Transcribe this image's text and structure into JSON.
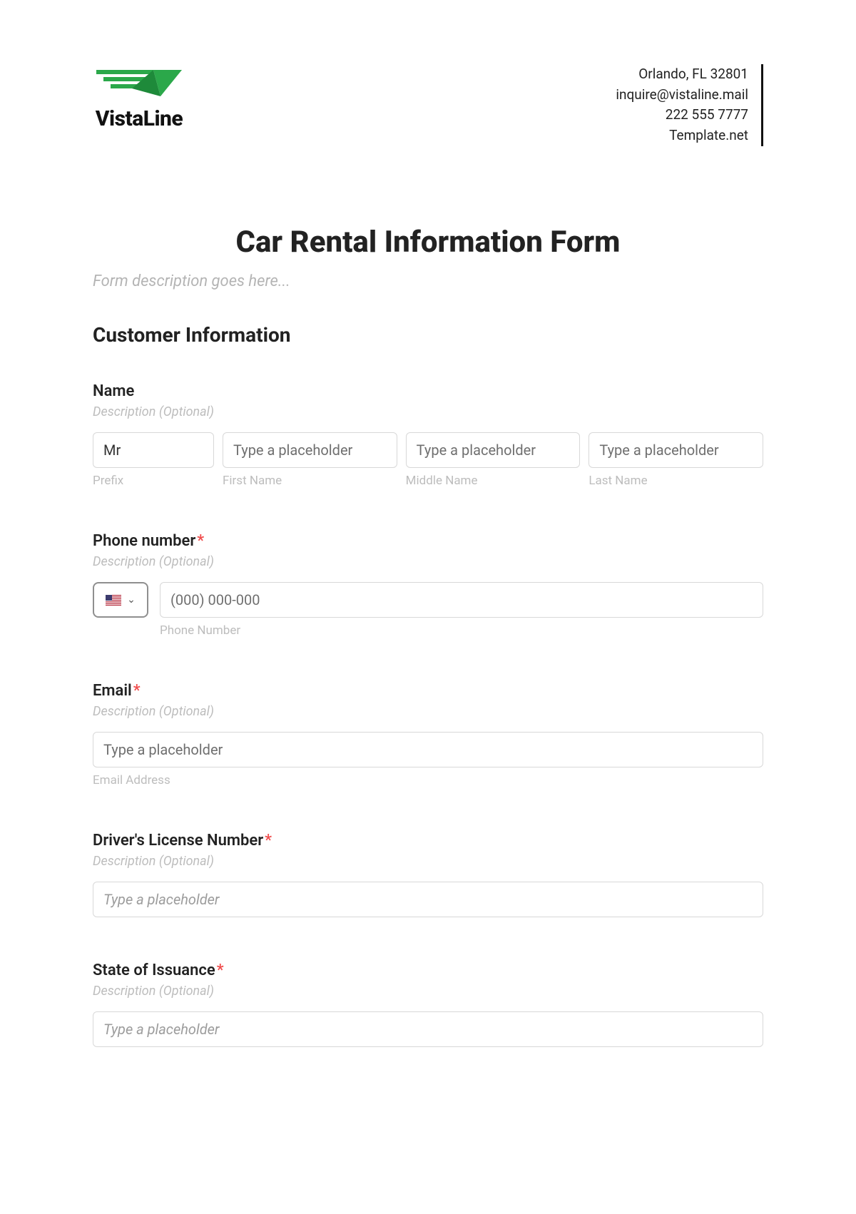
{
  "header": {
    "brand_name": "VistaLine",
    "address": [
      "Orlando, FL 32801",
      "inquire@vistaline.mail",
      "222 555 7777",
      "Template.net"
    ]
  },
  "form": {
    "title": "Car Rental Information Form",
    "description": "Form description goes here..."
  },
  "section": {
    "title": "Customer Information"
  },
  "name": {
    "label": "Name",
    "desc": "Description (Optional)",
    "prefix_value": "Mr",
    "prefix_sub": "Prefix",
    "first_placeholder": "Type a placeholder",
    "first_sub": "First Name",
    "middle_placeholder": "Type a placeholder",
    "middle_sub": "Middle Name",
    "last_placeholder": "Type a placeholder",
    "last_sub": "Last Name"
  },
  "phone": {
    "label": "Phone number",
    "desc": "Description (Optional)",
    "placeholder": "(000) 000-000",
    "sub": "Phone Number"
  },
  "email": {
    "label": "Email",
    "desc": "Description (Optional)",
    "placeholder": "Type a placeholder",
    "sub": "Email Address"
  },
  "license": {
    "label": "Driver's License Number",
    "desc": "Description (Optional)",
    "placeholder": "Type a placeholder"
  },
  "state": {
    "label": "State of Issuance",
    "desc": "Description (Optional)",
    "placeholder": "Type a placeholder"
  }
}
